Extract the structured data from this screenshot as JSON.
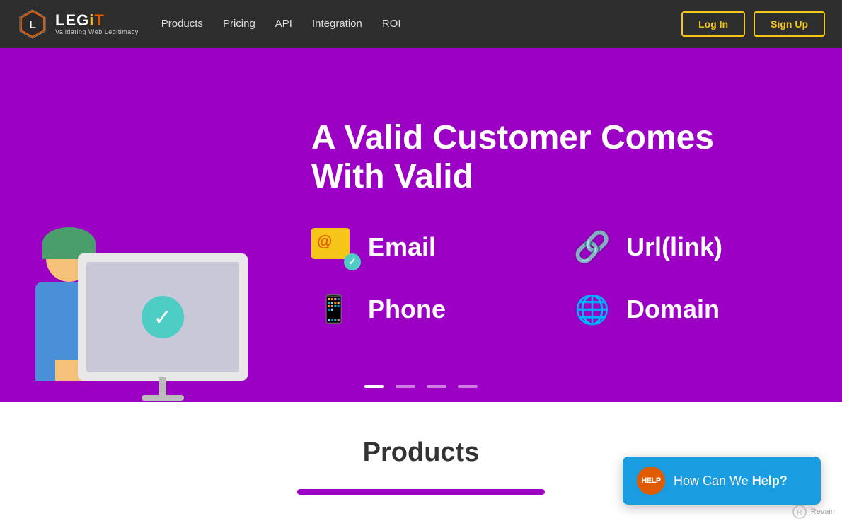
{
  "brand": {
    "name_leg": "LEG",
    "name_i": "i",
    "name_t": "T",
    "subtitle": "Validating Web Legitimacy"
  },
  "navbar": {
    "links": [
      {
        "label": "Products",
        "href": "#"
      },
      {
        "label": "Pricing",
        "href": "#"
      },
      {
        "label": "API",
        "href": "#"
      },
      {
        "label": "Integration",
        "href": "#"
      },
      {
        "label": "ROI",
        "href": "#"
      }
    ],
    "login_label": "Log In",
    "signup_label": "Sign Up"
  },
  "hero": {
    "title_line1": "A Valid Customer Comes",
    "title_line2": "With Valid",
    "features": [
      {
        "id": "email",
        "label": "Email",
        "icon": "email-icon"
      },
      {
        "id": "url",
        "label": "Url(link)",
        "icon": "url-icon"
      },
      {
        "id": "phone",
        "label": "Phone",
        "icon": "phone-icon"
      },
      {
        "id": "domain",
        "label": "Domain",
        "icon": "domain-icon"
      }
    ],
    "dots": [
      {
        "active": true
      },
      {
        "active": false
      },
      {
        "active": false
      },
      {
        "active": false
      }
    ]
  },
  "products_section": {
    "title": "Products"
  },
  "help_widget": {
    "badge": "HELP",
    "text_prefix": "How Can We ",
    "text_bold": "Help?"
  }
}
